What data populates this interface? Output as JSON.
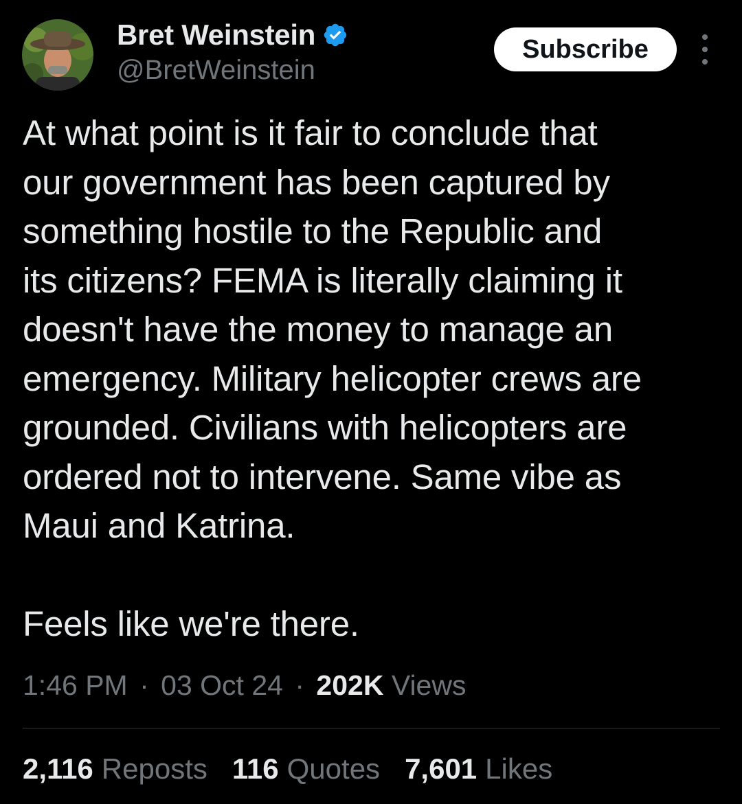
{
  "author": {
    "display_name": "Bret Weinstein",
    "handle": "@BretWeinstein",
    "verified": true,
    "avatar_icon": "avatar-photo"
  },
  "actions": {
    "subscribe_label": "Subscribe",
    "more_icon": "more-vertical-icon"
  },
  "tweet": {
    "text": "At what point is it fair to conclude that\nour government has been captured by\nsomething hostile to the Republic and\nits citizens? FEMA is literally claiming it\ndoesn't have the money to manage an\nemergency. Military helicopter crews are\ngrounded. Civilians with helicopters are\nordered not to intervene. Same vibe as\nMaui and Katrina.\n\nFeels like we're there.",
    "time": "1:46 PM",
    "separator": "·",
    "date": "03 Oct 24",
    "views_count": "202K",
    "views_label": "Views"
  },
  "stats": [
    {
      "count": "2,116",
      "label": "Reposts"
    },
    {
      "count": "116",
      "label": "Quotes"
    },
    {
      "count": "7,601",
      "label": "Likes"
    }
  ],
  "colors": {
    "background": "#000000",
    "primary_text": "#e7e9ea",
    "secondary_text": "#71767b",
    "verified_blue": "#1d9bf0",
    "divider": "#2f3336"
  }
}
